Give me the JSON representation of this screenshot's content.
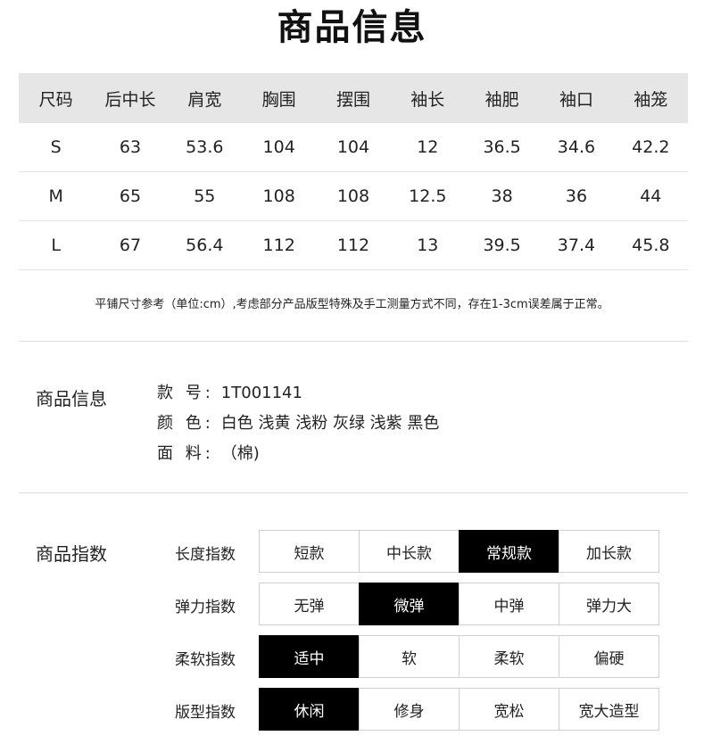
{
  "title": "商品信息",
  "size_table": {
    "headers": [
      "尺码",
      "后中长",
      "肩宽",
      "胸围",
      "摆围",
      "袖长",
      "袖肥",
      "袖口",
      "袖笼"
    ],
    "rows": [
      [
        "S",
        "63",
        "53.6",
        "104",
        "104",
        "12",
        "36.5",
        "34.6",
        "42.2"
      ],
      [
        "M",
        "65",
        "55",
        "108",
        "108",
        "12.5",
        "38",
        "36",
        "44"
      ],
      [
        "L",
        "67",
        "56.4",
        "112",
        "112",
        "13",
        "39.5",
        "37.4",
        "45.8"
      ]
    ]
  },
  "note": "平铺尺寸参考（单位:cm）,考虑部分产品版型特殊及手工测量方式不同，存在1-3cm误差属于正常。",
  "product_info": {
    "label": "商品信息",
    "rows": [
      {
        "key": "款 号:",
        "value": "1T001141"
      },
      {
        "key": "颜 色:",
        "value": "白色 浅黄 浅粉 灰绿 浅紫 黑色"
      },
      {
        "key": "面 料:",
        "value": "（棉)"
      }
    ]
  },
  "product_index": {
    "label": "商品指数",
    "rows": [
      {
        "name": "长度指数",
        "options": [
          "短款",
          "中长款",
          "常规款",
          "加长款"
        ],
        "selected": "常规款"
      },
      {
        "name": "弹力指数",
        "options": [
          "无弹",
          "微弹",
          "中弹",
          "弹力大"
        ],
        "selected": "微弹"
      },
      {
        "name": "柔软指数",
        "options": [
          "适中",
          "软",
          "柔软",
          "偏硬"
        ],
        "selected": "适中"
      },
      {
        "name": "版型指数",
        "options": [
          "休闲",
          "修身",
          "宽松",
          "宽大造型"
        ],
        "selected": "休闲"
      }
    ]
  }
}
